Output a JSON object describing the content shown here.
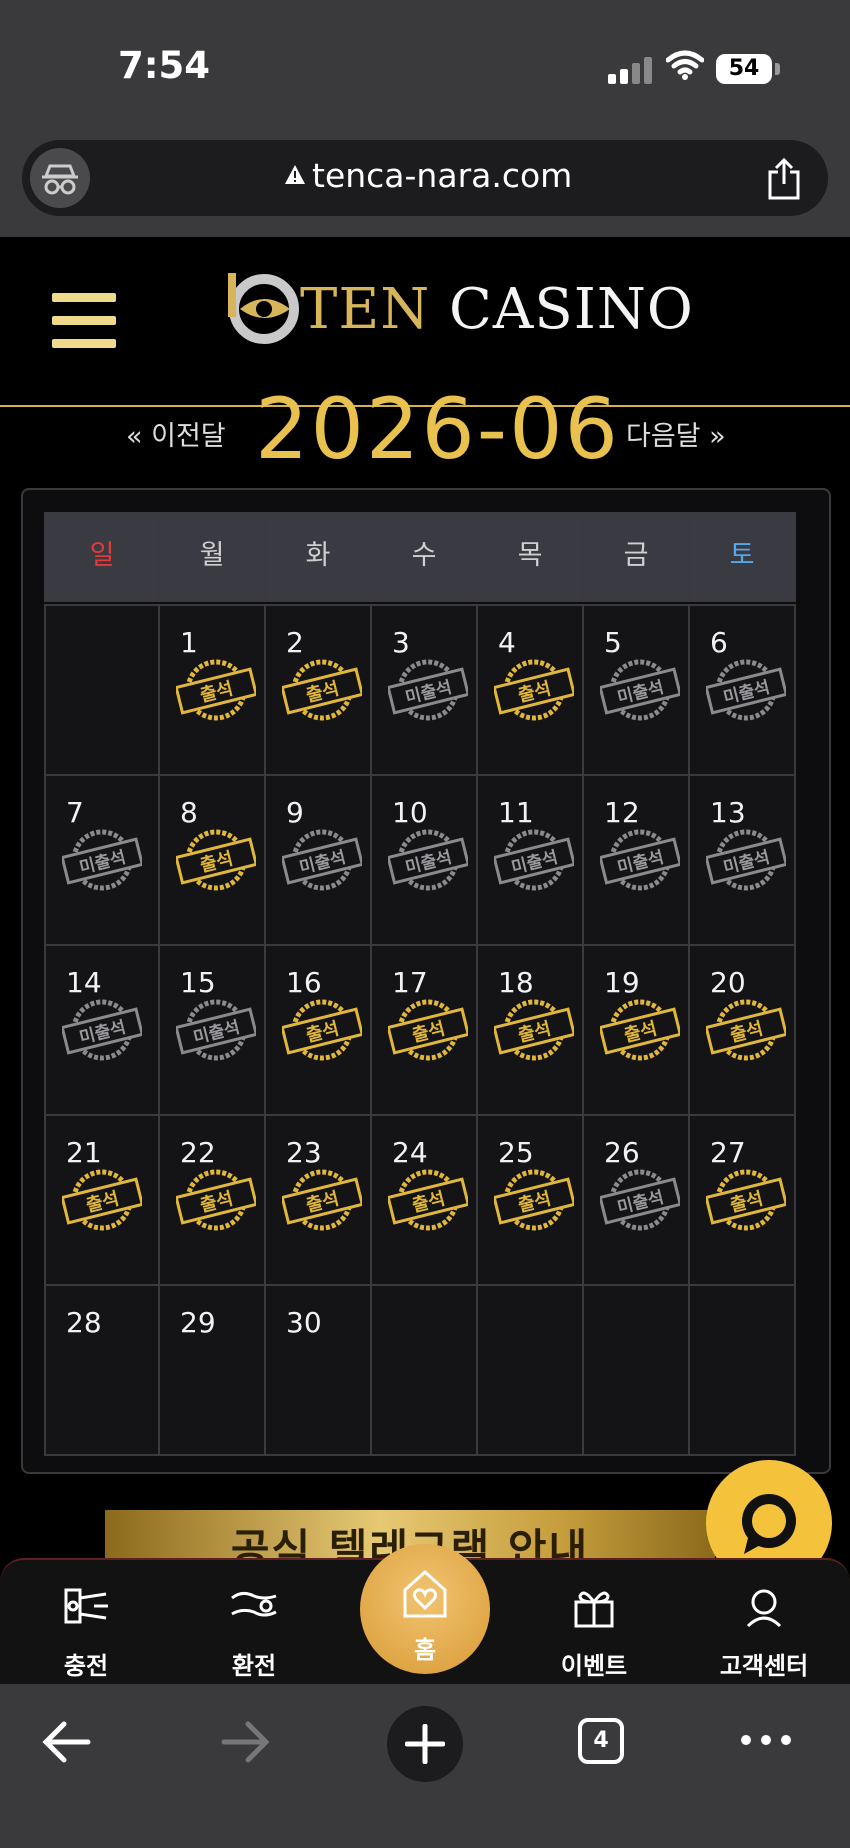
{
  "status_bar": {
    "time": "7:54",
    "battery": "54"
  },
  "browser": {
    "url": "tenca-nara.com",
    "tab_count": "4"
  },
  "site": {
    "logo_ten": "TEN",
    "logo_casino": "CASINO"
  },
  "month_nav": {
    "prev": "« 이전달",
    "current": "2026-06",
    "next": "다음달 »"
  },
  "calendar": {
    "weekdays": [
      "일",
      "월",
      "화",
      "수",
      "목",
      "금",
      "토"
    ],
    "stamp_labels": {
      "attended": "출석",
      "absent": "미출석"
    },
    "weeks": [
      [
        null,
        {
          "d": "1",
          "s": "attended"
        },
        {
          "d": "2",
          "s": "attended"
        },
        {
          "d": "3",
          "s": "absent"
        },
        {
          "d": "4",
          "s": "attended"
        },
        {
          "d": "5",
          "s": "absent"
        },
        {
          "d": "6",
          "s": "absent"
        }
      ],
      [
        {
          "d": "7",
          "s": "absent"
        },
        {
          "d": "8",
          "s": "attended"
        },
        {
          "d": "9",
          "s": "absent"
        },
        {
          "d": "10",
          "s": "absent"
        },
        {
          "d": "11",
          "s": "absent"
        },
        {
          "d": "12",
          "s": "absent"
        },
        {
          "d": "13",
          "s": "absent"
        }
      ],
      [
        {
          "d": "14",
          "s": "absent"
        },
        {
          "d": "15",
          "s": "absent"
        },
        {
          "d": "16",
          "s": "attended"
        },
        {
          "d": "17",
          "s": "attended"
        },
        {
          "d": "18",
          "s": "attended"
        },
        {
          "d": "19",
          "s": "attended"
        },
        {
          "d": "20",
          "s": "attended"
        }
      ],
      [
        {
          "d": "21",
          "s": "attended"
        },
        {
          "d": "22",
          "s": "attended"
        },
        {
          "d": "23",
          "s": "attended"
        },
        {
          "d": "24",
          "s": "attended"
        },
        {
          "d": "25",
          "s": "attended"
        },
        {
          "d": "26",
          "s": "absent"
        },
        {
          "d": "27",
          "s": "attended"
        }
      ],
      [
        {
          "d": "28",
          "s": ""
        },
        {
          "d": "29",
          "s": ""
        },
        {
          "d": "30",
          "s": ""
        },
        null,
        null,
        null,
        null
      ]
    ]
  },
  "banner": {
    "text": "공식 텔레그램 안내"
  },
  "bottom_nav": {
    "charge": "충전",
    "exchange": "환전",
    "home": "홈",
    "event": "이벤트",
    "support": "고객센터"
  },
  "colors": {
    "gold": "#e8c14e",
    "accent_yellow": "#f5c33b",
    "sunday": "#e23a3a",
    "saturday": "#52a8e8"
  }
}
